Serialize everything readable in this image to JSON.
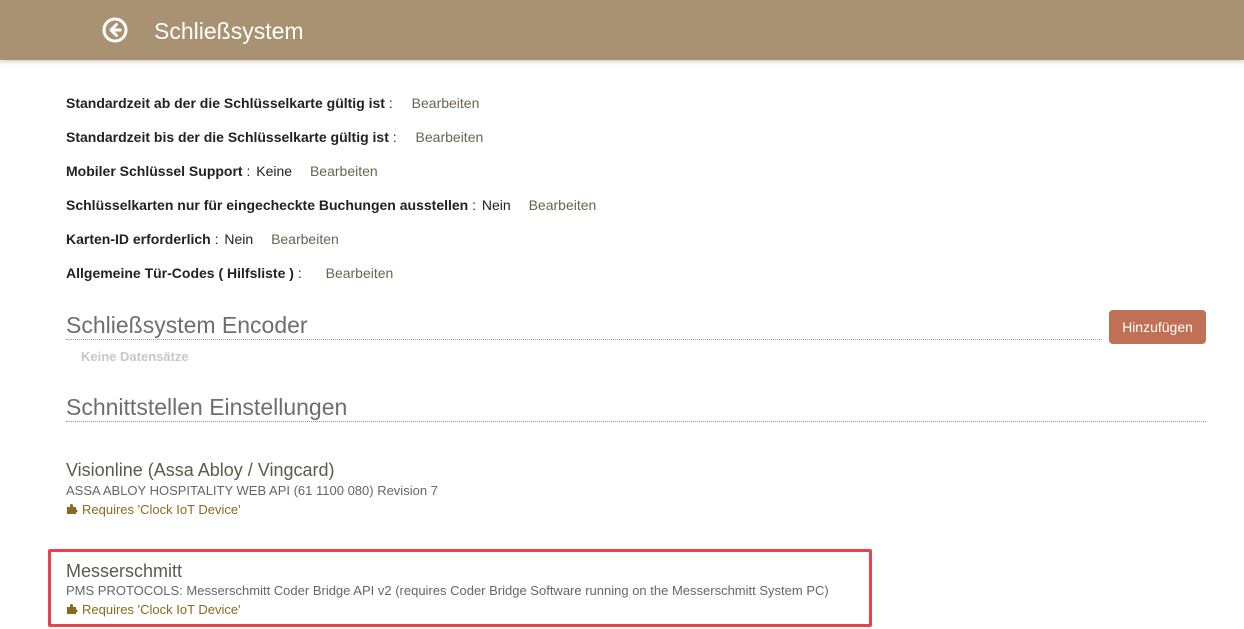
{
  "header": {
    "title": "Schließsystem",
    "back_icon": "back-arrow-circle-icon"
  },
  "settings": [
    {
      "label": "Standardzeit ab der die Schlüsselkarte gültig ist",
      "sep": " :",
      "value": "",
      "edit": "Bearbeiten"
    },
    {
      "label": "Standardzeit bis der die Schlüsselkarte gültig ist",
      "sep": " :",
      "value": "",
      "edit": "Bearbeiten"
    },
    {
      "label": "Mobiler Schlüssel Support",
      "sep": " :",
      "value": "Keine",
      "edit": "Bearbeiten"
    },
    {
      "label": "Schlüsselkarten nur für eingecheckte Buchungen ausstellen",
      "sep": " :",
      "value": "Nein",
      "edit": "Bearbeiten"
    },
    {
      "label": "Karten-ID erforderlich",
      "sep": " :",
      "value": "Nein",
      "edit": "Bearbeiten"
    },
    {
      "label": "Allgemeine Tür-Codes ( Hilfsliste )",
      "sep": " :",
      "value": "",
      "edit": "Bearbeiten"
    }
  ],
  "encoder_section": {
    "title": "Schließsystem Encoder",
    "add_button": "Hinzufügen",
    "empty_text": "Keine Datensätze"
  },
  "interface_section": {
    "title": "Schnittstellen Einstellungen",
    "items": [
      {
        "name": "Visionline (Assa Abloy / Vingcard)",
        "description": "ASSA ABLOY HOSPITALITY WEB API (61 1100 080) Revision 7",
        "requirement": "Requires 'Clock IoT Device'",
        "requirement_icon": "puzzle-piece-icon"
      },
      {
        "name": "Messerschmitt",
        "description": "PMS PROTOCOLS: Messerschmitt Coder Bridge API v2 (requires Coder Bridge Software running on the Messerschmitt System PC)",
        "requirement": "Requires 'Clock IoT Device'",
        "requirement_icon": "puzzle-piece-icon"
      }
    ]
  },
  "colors": {
    "header_bg": "#a89272",
    "accent_button": "#c07055",
    "highlight": "#e8434b"
  }
}
